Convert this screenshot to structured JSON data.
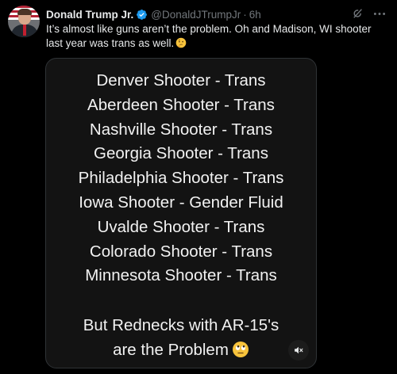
{
  "post": {
    "author_name": "Donald Trump Jr.",
    "author_handle": "@DonaldJTrumpJr",
    "separator": "·",
    "timestamp": "6h",
    "text": "It’s almost like guns aren’t the problem. Oh and Madison, WI shooter last year was trans as well.",
    "text_emoji": "thinking-face-emoji"
  },
  "media": {
    "lines": [
      "Denver Shooter - Trans",
      "Aberdeen Shooter - Trans",
      "Nashville Shooter - Trans",
      "Georgia Shooter - Trans",
      "Philadelphia Shooter - Trans",
      "Iowa Shooter - Gender Fluid",
      "Uvalde Shooter - Trans",
      "Colorado Shooter - Trans",
      "Minnesota Shooter - Trans"
    ],
    "footer_line1": "But Rednecks with AR-15's",
    "footer_line2": "are the Problem",
    "footer_emoji": "face-with-rolling-eyes-emoji",
    "mute_icon": "muted-speaker-icon"
  },
  "colors": {
    "background": "#000000",
    "text_primary": "#e7e9ea",
    "text_secondary": "#71767b",
    "verified_badge": "#1d9bf0",
    "media_background": "#131313",
    "media_border": "#2f3336"
  }
}
